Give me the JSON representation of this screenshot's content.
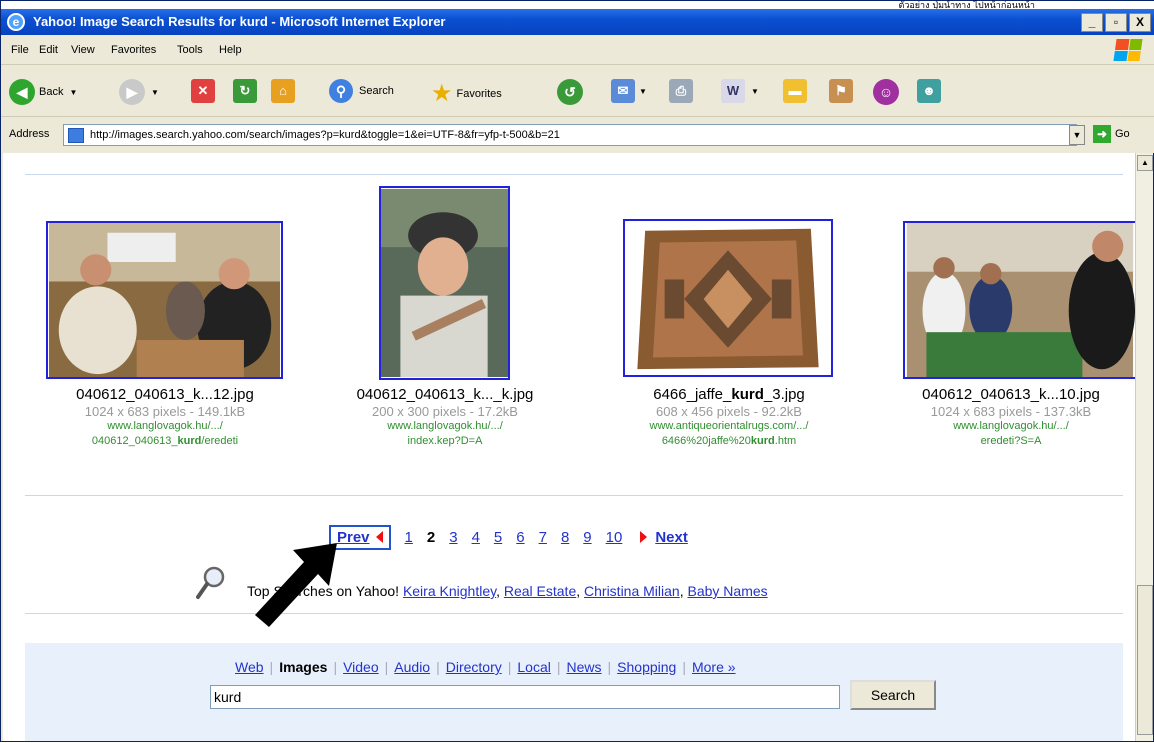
{
  "annotation_text": "ตัวอย่าง ปุ่มนำทาง ไปหน้าก่อนหน้า",
  "window": {
    "title": "Yahoo! Image Search Results for kurd - Microsoft Internet Explorer",
    "minimize": "_",
    "maximize": "▫",
    "close": "X"
  },
  "menu": [
    "File",
    "Edit",
    "View",
    "Favorites",
    "Tools",
    "Help"
  ],
  "toolbar": {
    "back": "Back",
    "search": "Search",
    "favorites": "Favorites"
  },
  "address": {
    "label": "Address",
    "url": "http://images.search.yahoo.com/search/images?p=kurd&toggle=1&ei=UTF-8&fr=yfp-t-500&b=21",
    "go": "Go"
  },
  "results": [
    {
      "filename": "040612_040613_k...12.jpg",
      "size": "1024 x 683 pixels - 149.1kB",
      "url1": "www.langlovagok.hu/.../",
      "url2_pre": "040612_040613_",
      "url2_bold": "kurd",
      "url2_post": "/eredeti"
    },
    {
      "filename": "040612_040613_k..._k.jpg",
      "size": "200 x 300 pixels - 17.2kB",
      "url1": "www.langlovagok.hu/.../",
      "url2_pre": "index.kep?D=A",
      "url2_bold": "",
      "url2_post": ""
    },
    {
      "filename_pre": "6466_jaffe_",
      "filename_bold": "kurd",
      "filename_post": "_3.jpg",
      "size": "608 x 456 pixels - 92.2kB",
      "url1": "www.antiqueorientalrugs.com/.../",
      "url2_pre": "6466%20jaffe%20",
      "url2_bold": "kurd",
      "url2_post": ".htm"
    },
    {
      "filename": "040612_040613_k...10.jpg",
      "size": "1024 x 683 pixels - 137.3kB",
      "url1": "www.langlovagok.hu/.../",
      "url2_pre": "eredeti?S=A",
      "url2_bold": "",
      "url2_post": ""
    }
  ],
  "pager": {
    "prev": "Prev",
    "pages": [
      "1",
      "2",
      "3",
      "4",
      "5",
      "6",
      "7",
      "8",
      "9",
      "10"
    ],
    "current": "2",
    "next": "Next"
  },
  "top_searches": {
    "label": "Top Searches on Yahoo!",
    "links": [
      "Keira Knightley",
      "Real Estate",
      "Christina Milian",
      "Baby Names"
    ]
  },
  "verticals": [
    "Web",
    "Images",
    "Video",
    "Audio",
    "Directory",
    "Local",
    "News",
    "Shopping",
    "More »"
  ],
  "current_vertical": "Images",
  "search": {
    "value": "kurd",
    "button": "Search"
  },
  "colors": {
    "link": "#2233cc",
    "url_green": "#2f8f2f",
    "highlight_border": "#2255cc",
    "arrow": "#000000",
    "titlebar": "#0a4fd0"
  }
}
